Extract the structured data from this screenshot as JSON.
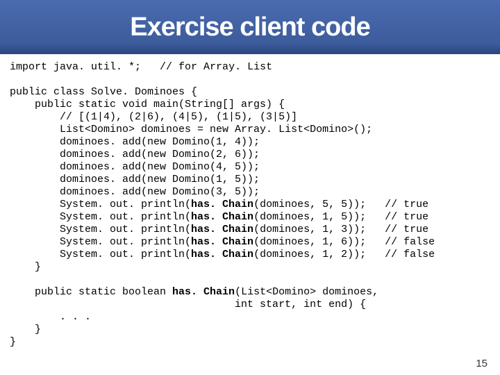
{
  "title": "Exercise client code",
  "code": {
    "l1a": "import java. util. *;   ",
    "l1b": "// for Array. List",
    "l2": "public class Solve. Dominoes {",
    "l3": "    public static void main(String[] args) {",
    "l4": "        // [(1|4), (2|6), (4|5), (1|5), (3|5)]",
    "l5": "        List<Domino> dominoes = new Array. List<Domino>();",
    "l6": "        dominoes. add(new Domino(1, 4));",
    "l7": "        dominoes. add(new Domino(2, 6));",
    "l8": "        dominoes. add(new Domino(4, 5));",
    "l9": "        dominoes. add(new Domino(1, 5));",
    "l10": "        dominoes. add(new Domino(3, 5));",
    "p1a": "        System. out. println(",
    "p1b": "has. Chain",
    "p1c": "(dominoes, 5, 5));   // true",
    "p2c": "(dominoes, 1, 5));   // true",
    "p3c": "(dominoes, 1, 3));   // true",
    "p4c": "(dominoes, 1, 6));   // false",
    "p5c": "(dominoes, 1, 2));   // false",
    "l16": "    }",
    "l17a": "    public static boolean ",
    "l17b": "has. Chain",
    "l17c": "(List<Domino> dominoes,",
    "l18": "                                    int start, int end) {",
    "l19": "        . . .",
    "l20": "    }",
    "l21": "}"
  },
  "pagenum": "15"
}
